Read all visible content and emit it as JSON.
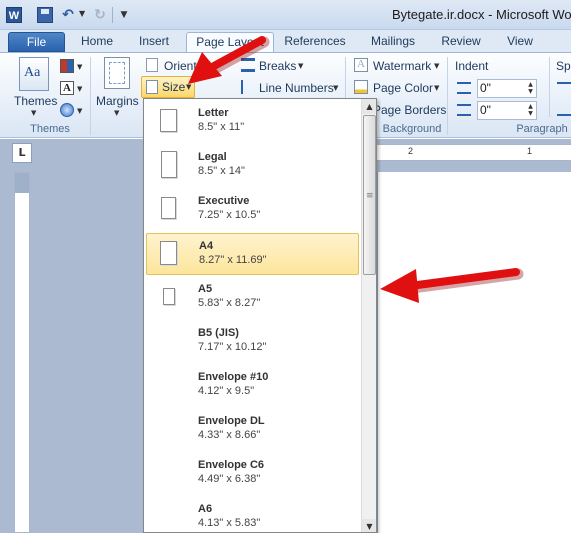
{
  "window": {
    "title": "Bytegate.ir.docx - Microsoft Word"
  },
  "quick_access": {
    "app_icon_letter": "W"
  },
  "tabs": [
    {
      "label": "File"
    },
    {
      "label": "Home"
    },
    {
      "label": "Insert"
    },
    {
      "label": "Page Layout"
    },
    {
      "label": "References"
    },
    {
      "label": "Mailings"
    },
    {
      "label": "Review"
    },
    {
      "label": "View"
    }
  ],
  "ribbon": {
    "themes_label": "Themes",
    "themes_group": "Themes",
    "margins_label": "Margins",
    "orientation_label": "Orient",
    "size_label": "Size",
    "breaks_label": "Breaks",
    "line_numbers_label": "Line Numbers",
    "watermark_label": "Watermark",
    "page_color_label": "Page Color",
    "page_borders_label": "Page Borders",
    "page_background_group": "Background",
    "indent_heading": "Indent",
    "indent_left_value": "0\"",
    "indent_right_value": "0\"",
    "spacing_heading": "Sp",
    "paragraph_group": "Paragraph"
  },
  "ruler": {
    "h_mark_1": "2",
    "h_mark_2": "1",
    "tab_selector": "L"
  },
  "size_gallery": {
    "items": [
      {
        "name": "Letter",
        "dims": "8.5\" x 11\""
      },
      {
        "name": "Legal",
        "dims": "8.5\" x 14\""
      },
      {
        "name": "Executive",
        "dims": "7.25\" x 10.5\""
      },
      {
        "name": "A4",
        "dims": "8.27\" x 11.69\"",
        "selected": true
      },
      {
        "name": "A5",
        "dims": "5.83\" x 8.27\""
      },
      {
        "name": "B5 (JIS)",
        "dims": "7.17\" x 10.12\""
      },
      {
        "name": "Envelope #10",
        "dims": "4.12\" x 9.5\""
      },
      {
        "name": "Envelope DL",
        "dims": "4.33\" x 8.66\""
      },
      {
        "name": "Envelope C6",
        "dims": "4.49\" x 6.38\""
      },
      {
        "name": "A6",
        "dims": "4.13\" x 5.83\""
      }
    ]
  },
  "colors": {
    "accent": "#2a62ad",
    "selection": "#fce59b",
    "annotation_arrow": "#e01010"
  },
  "icons": {
    "scroll_up": "▲",
    "scroll_down": "▼",
    "dropdown": "▼"
  }
}
